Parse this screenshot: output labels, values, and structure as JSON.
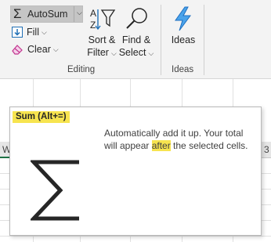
{
  "ribbon": {
    "autosum": {
      "label": "AutoSum"
    },
    "fill": {
      "label": "Fill"
    },
    "clear": {
      "label": "Clear"
    },
    "sort_filter": {
      "line1": "Sort &",
      "line2": "Filter"
    },
    "find_select": {
      "line1": "Find &",
      "line2": "Select"
    },
    "ideas": {
      "label": "Ideas"
    },
    "groups": {
      "editing": "Editing",
      "ideas": "Ideas"
    }
  },
  "sheet": {
    "col_left": "W",
    "col_right": "3"
  },
  "tooltip": {
    "title": "Sum (Alt+=)",
    "desc_before": "Automatically add it up. Your total will appear ",
    "desc_highlight": "after",
    "desc_after": " the selected cells."
  },
  "colors": {
    "highlight": "#f7e44f",
    "ideas_icon": "#1e88e5",
    "selected_column": "#1e7145"
  },
  "icons": [
    "sigma-icon",
    "fill-down-icon",
    "eraser-icon",
    "sort-az-filter-icon",
    "magnifier-icon",
    "lightning-icon",
    "chevron-down-icon"
  ]
}
